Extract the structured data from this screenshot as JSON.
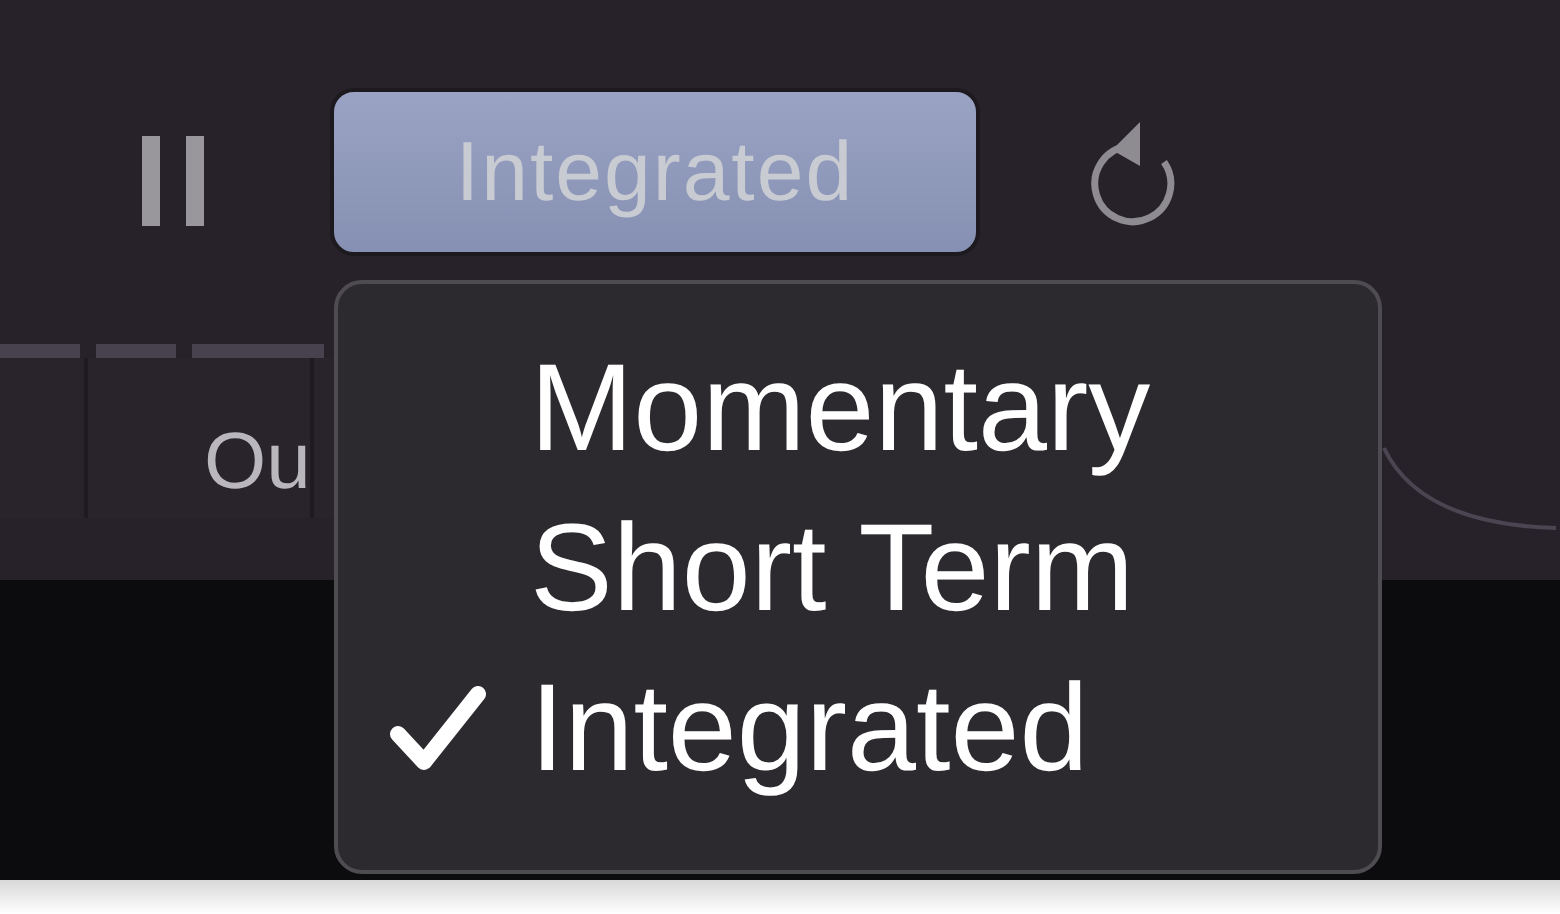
{
  "mode_button": {
    "label": "Integrated"
  },
  "meter": {
    "label": "Ou"
  },
  "menu": {
    "items": [
      {
        "label": "Momentary",
        "selected": false
      },
      {
        "label": "Short Term",
        "selected": false
      },
      {
        "label": "Integrated",
        "selected": true
      }
    ]
  }
}
